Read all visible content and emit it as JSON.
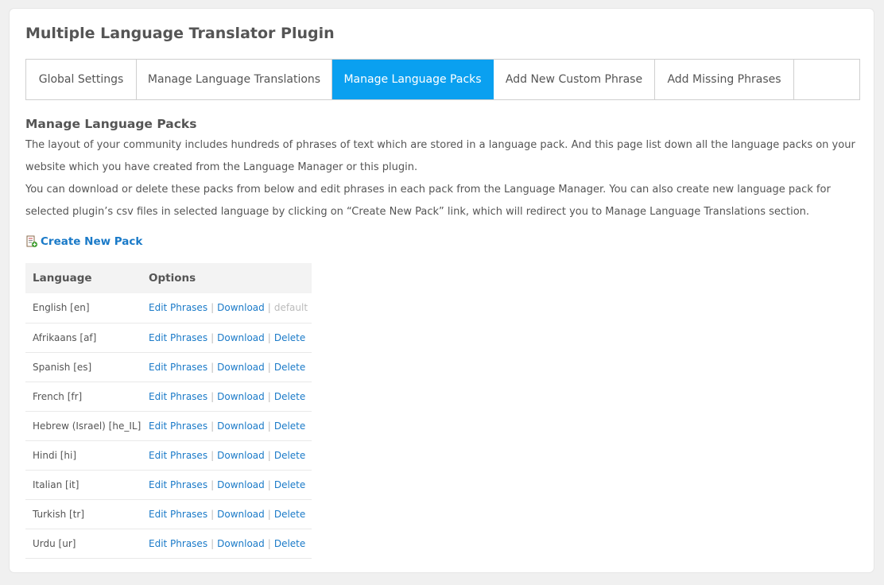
{
  "page": {
    "title": "Multiple Language Translator Plugin"
  },
  "tabs": [
    {
      "label": "Global Settings",
      "active": false
    },
    {
      "label": "Manage Language Translations",
      "active": false
    },
    {
      "label": "Manage Language Packs",
      "active": true
    },
    {
      "label": "Add New Custom Phrase",
      "active": false
    },
    {
      "label": "Add Missing Phrases",
      "active": false
    }
  ],
  "section": {
    "heading": "Manage Language Packs",
    "paragraph1": "The layout of your community includes hundreds of phrases of text which are stored in a language pack. And this page list down all the language packs on your website which you have created from the Language Manager or this plugin.",
    "paragraph2": "You can download or delete these packs from below and edit phrases in each pack from the Language Manager. You can also create new language pack for selected plugin’s csv files in selected language by clicking on “Create New Pack” link, which will redirect you to Manage Language Translations section."
  },
  "create_link": {
    "label": "Create New Pack",
    "icon": "add-document-icon"
  },
  "table": {
    "headers": {
      "language": "Language",
      "options": "Options"
    },
    "separator": "|",
    "rows": [
      {
        "language": "English [en]",
        "edit": "Edit Phrases",
        "download": "Download",
        "third": "default",
        "third_type": "default"
      },
      {
        "language": "Afrikaans [af]",
        "edit": "Edit Phrases",
        "download": "Download",
        "third": "Delete",
        "third_type": "delete"
      },
      {
        "language": "Spanish [es]",
        "edit": "Edit Phrases",
        "download": "Download",
        "third": "Delete",
        "third_type": "delete"
      },
      {
        "language": "French [fr]",
        "edit": "Edit Phrases",
        "download": "Download",
        "third": "Delete",
        "third_type": "delete"
      },
      {
        "language": "Hebrew (Israel) [he_IL]",
        "edit": "Edit Phrases",
        "download": "Download",
        "third": "Delete",
        "third_type": "delete"
      },
      {
        "language": "Hindi [hi]",
        "edit": "Edit Phrases",
        "download": "Download",
        "third": "Delete",
        "third_type": "delete"
      },
      {
        "language": "Italian [it]",
        "edit": "Edit Phrases",
        "download": "Download",
        "third": "Delete",
        "third_type": "delete"
      },
      {
        "language": "Turkish [tr]",
        "edit": "Edit Phrases",
        "download": "Download",
        "third": "Delete",
        "third_type": "delete"
      },
      {
        "language": "Urdu [ur]",
        "edit": "Edit Phrases",
        "download": "Download",
        "third": "Delete",
        "third_type": "delete"
      }
    ]
  },
  "colors": {
    "accent": "#0aa0f0",
    "link": "#1a7ac8",
    "muted": "#bbbbbb"
  }
}
